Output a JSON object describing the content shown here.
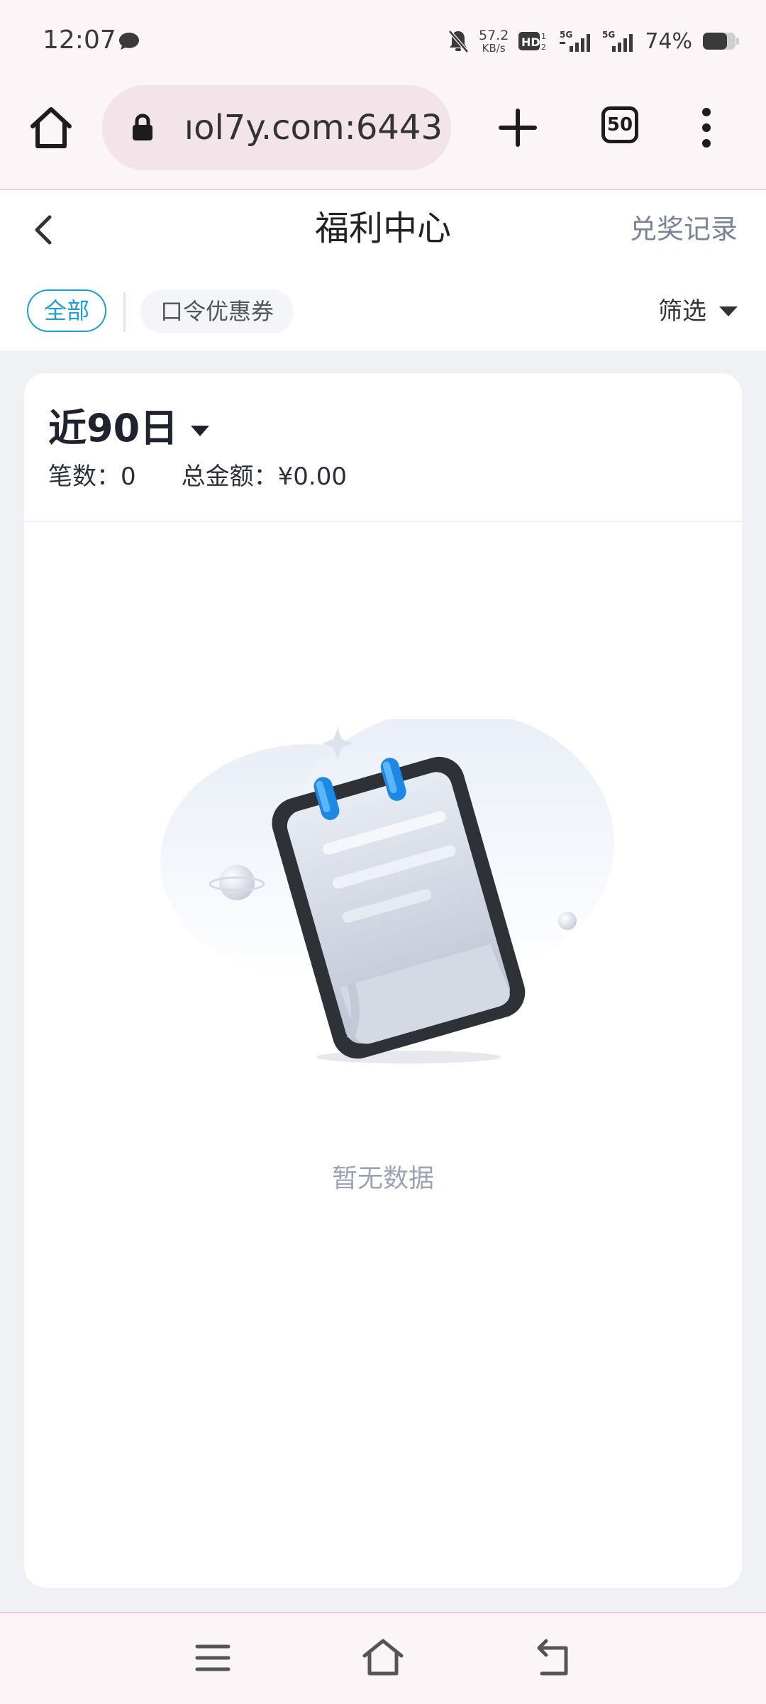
{
  "status_bar": {
    "time": "12:07",
    "net_speed_value": "57.2",
    "net_speed_unit": "KB/s",
    "battery_percent": "74%",
    "icons": [
      "chat-icon",
      "mute-bell-icon",
      "hd-icon",
      "signal-5g-icon",
      "signal-5g-icon",
      "battery-icon"
    ]
  },
  "browser": {
    "url": "ıol7y.com:6443",
    "tab_count": "50"
  },
  "header": {
    "title": "福利中心",
    "records_link": "兑奖记录"
  },
  "filters": {
    "chips": [
      "全部",
      "口令优惠券"
    ],
    "active_chip": "全部",
    "filter_label": "筛选"
  },
  "summary": {
    "period": "近90日",
    "count_label": "笔数：",
    "count_value": "0",
    "amount_label": "总金额：",
    "amount_value": "¥0.00"
  },
  "empty_state": {
    "message": "暂无数据"
  },
  "colors": {
    "accent": "#1c9fd6",
    "chrome_bg": "#fcf5f8",
    "page_bg": "#f0f1f5",
    "muted_text": "#9aa3b5"
  }
}
